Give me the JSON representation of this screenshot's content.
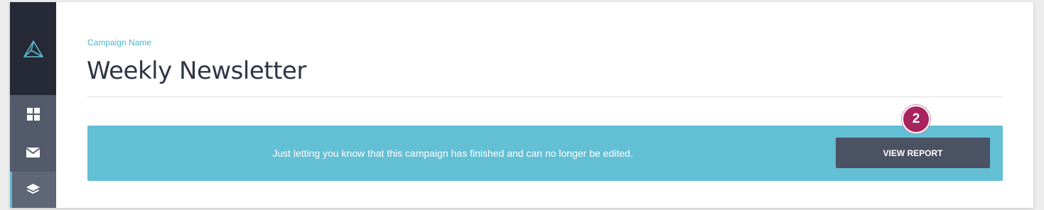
{
  "sidebar": {
    "logo_icon": "triangle-logo-icon",
    "items": [
      {
        "icon": "dashboard-grid-icon",
        "active": false
      },
      {
        "icon": "envelope-icon",
        "active": false
      },
      {
        "icon": "layers-icon",
        "active": true
      }
    ]
  },
  "header": {
    "label": "Campaign Name",
    "title": "Weekly Newsletter"
  },
  "banner": {
    "message": "Just letting you know that this campaign has finished and can no longer be edited.",
    "button_label": "VIEW REPORT"
  },
  "step_badge": "2",
  "colors": {
    "accent": "#62bfd4",
    "sidebar_dark": "#262a36",
    "sidebar": "#535b6b",
    "button": "#4b5263",
    "badge": "#a7245e"
  }
}
